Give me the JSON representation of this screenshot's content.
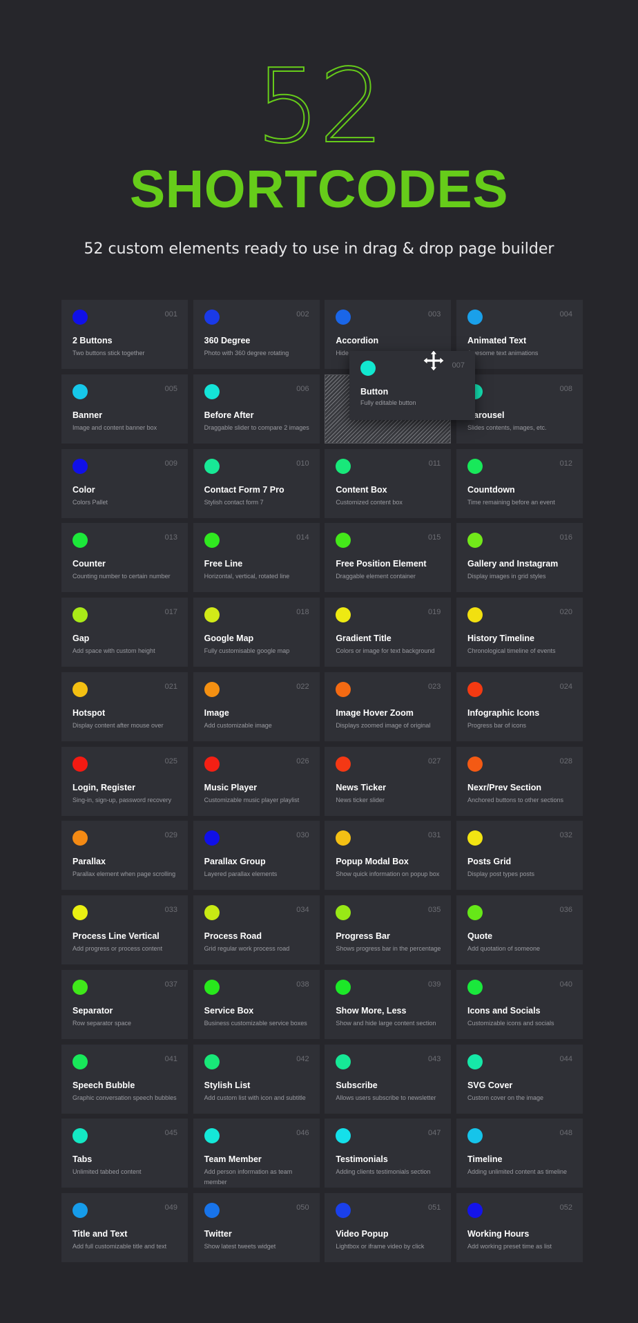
{
  "hero": {
    "number": "52",
    "title": "SHORTCODES",
    "subtitle": "52 custom elements ready to use in drag & drop page builder"
  },
  "colors": {
    "background": "#26262b",
    "card": "#2f3036",
    "accent": "#66cc1a"
  },
  "drag_preview": {
    "number": "007",
    "name": "Button",
    "desc": "Fully editable button",
    "color": "#12e8d0",
    "cursor_icon": "move-icon"
  },
  "shortcodes": [
    {
      "num": "001",
      "name": "2 Buttons",
      "desc": "Two buttons stick together",
      "color": "#1010e8"
    },
    {
      "num": "002",
      "name": "360 Degree",
      "desc": "Photo with 360 degree rotating",
      "color": "#1a3ae8"
    },
    {
      "num": "003",
      "name": "Accordion",
      "desc": "Hide",
      "color": "#1a66e8"
    },
    {
      "num": "004",
      "name": "Animated Text",
      "desc": "Awesome text animations",
      "color": "#1aa0ea"
    },
    {
      "num": "005",
      "name": "Banner",
      "desc": "Image and content banner box",
      "color": "#16c8ea"
    },
    {
      "num": "006",
      "name": "Before After",
      "desc": "Draggable slider to compare 2 images",
      "color": "#14e4d8"
    },
    {
      "placeholder": true
    },
    {
      "num": "008",
      "name": "Carousel",
      "desc": "Slides contents, images, etc.",
      "color": "#14e8b8"
    },
    {
      "num": "009",
      "name": "Color",
      "desc": "Colors Pallet",
      "color": "#1010e8"
    },
    {
      "num": "010",
      "name": "Contact Form 7 Pro",
      "desc": "Stylish contact form 7",
      "color": "#18e896"
    },
    {
      "num": "011",
      "name": "Content Box",
      "desc": "Customized content box",
      "color": "#18e87a"
    },
    {
      "num": "012",
      "name": "Countdown",
      "desc": "Time remaining before an event",
      "color": "#18e85a"
    },
    {
      "num": "013",
      "name": "Counter",
      "desc": "Counting number to certain number",
      "color": "#1ce83a"
    },
    {
      "num": "014",
      "name": "Free Line",
      "desc": "Horizontal, vertical, rotated line",
      "color": "#30e820"
    },
    {
      "num": "015",
      "name": "Free Position Element",
      "desc": "Draggable element container",
      "color": "#44e81a"
    },
    {
      "num": "016",
      "name": "Gallery and Instagram",
      "desc": "Display images in grid styles",
      "color": "#72e81a"
    },
    {
      "num": "017",
      "name": "Gap",
      "desc": "Add space with custom height",
      "color": "#aaea18"
    },
    {
      "num": "018",
      "name": "Google Map",
      "desc": "Fully customisable google map",
      "color": "#d2ea18"
    },
    {
      "num": "019",
      "name": "Gradient Title",
      "desc": "Colors or image for text background",
      "color": "#eeea12"
    },
    {
      "num": "020",
      "name": "History Timeline",
      "desc": "Chronological timeline of events",
      "color": "#f2e010"
    },
    {
      "num": "021",
      "name": "Hotspot",
      "desc": "Display content after mouse over",
      "color": "#f4c012"
    },
    {
      "num": "022",
      "name": "Image",
      "desc": "Add customizable image",
      "color": "#f49012"
    },
    {
      "num": "023",
      "name": "Image Hover Zoom",
      "desc": "Displays zoomed image of original",
      "color": "#f46a12"
    },
    {
      "num": "024",
      "name": "Infographic Icons",
      "desc": "Progress bar of icons",
      "color": "#f43a12"
    },
    {
      "num": "025",
      "name": "Login, Register",
      "desc": "Sing-in, sign-up, password recovery",
      "color": "#f41a12"
    },
    {
      "num": "026",
      "name": "Music Player",
      "desc": "Customizable music player playlist",
      "color": "#f42014"
    },
    {
      "num": "027",
      "name": "News Ticker",
      "desc": "News ticker slider",
      "color": "#f43814"
    },
    {
      "num": "028",
      "name": "Nexr/Prev Section",
      "desc": "Anchored buttons to other sections",
      "color": "#f45a14"
    },
    {
      "num": "029",
      "name": "Parallax",
      "desc": "Parallax element when page scrolling",
      "color": "#f48a14"
    },
    {
      "num": "030",
      "name": "Parallax Group",
      "desc": "Layered parallax elements",
      "color": "#1010e8"
    },
    {
      "num": "031",
      "name": "Popup Modal Box",
      "desc": "Show quick information on popup box",
      "color": "#f4c014"
    },
    {
      "num": "032",
      "name": "Posts Grid",
      "desc": "Display post types posts",
      "color": "#f2e412"
    },
    {
      "num": "033",
      "name": "Process Line Vertical",
      "desc": "Add progress or process content",
      "color": "#eaf012"
    },
    {
      "num": "034",
      "name": "Process Road",
      "desc": "Grid regular work process road",
      "color": "#c8ea14"
    },
    {
      "num": "035",
      "name": "Progress Bar",
      "desc": "Shows progress bar in the percentage",
      "color": "#98e816"
    },
    {
      "num": "036",
      "name": "Quote",
      "desc": "Add quotation of someone",
      "color": "#66e818"
    },
    {
      "num": "037",
      "name": "Separator",
      "desc": "Row separator space",
      "color": "#40e81a"
    },
    {
      "num": "038",
      "name": "Service Box",
      "desc": "Business customizable service boxes",
      "color": "#28e81c"
    },
    {
      "num": "039",
      "name": "Show More, Less",
      "desc": "Show and hide large content section",
      "color": "#1ce828"
    },
    {
      "num": "040",
      "name": "Icons and Socials",
      "desc": "Customizable icons and socials",
      "color": "#1ae83c"
    },
    {
      "num": "041",
      "name": "Speech Bubble",
      "desc": "Graphic conversation speech bubbles",
      "color": "#18e85a"
    },
    {
      "num": "042",
      "name": "Stylish List",
      "desc": "Add custom list with icon and subtitle",
      "color": "#18e878"
    },
    {
      "num": "043",
      "name": "Subscribe",
      "desc": "Allows users subscribe to newsletter",
      "color": "#16e896"
    },
    {
      "num": "044",
      "name": "SVG Cover",
      "desc": "Custom cover on the image",
      "color": "#16e8a8"
    },
    {
      "num": "045",
      "name": "Tabs",
      "desc": "Unlimited tabbed content",
      "color": "#14e8c4"
    },
    {
      "num": "046",
      "name": "Team Member",
      "desc": "Add person information as team member",
      "color": "#14e8d8"
    },
    {
      "num": "047",
      "name": "Testimonials",
      "desc": "Adding clients testimonials section",
      "color": "#14e0ea"
    },
    {
      "num": "048",
      "name": "Timeline",
      "desc": "Adding unlimited content as timeline",
      "color": "#16c4ea"
    },
    {
      "num": "049",
      "name": "Title and Text",
      "desc": "Add full customizable title and text",
      "color": "#169cea"
    },
    {
      "num": "050",
      "name": "Twitter",
      "desc": "Show latest tweets widget",
      "color": "#1874ea"
    },
    {
      "num": "051",
      "name": "Video Popup",
      "desc": "Lightbox or iframe video by click",
      "color": "#1a40ea"
    },
    {
      "num": "052",
      "name": "Working Hours",
      "desc": "Add working preset time as list",
      "color": "#1414ea"
    }
  ]
}
